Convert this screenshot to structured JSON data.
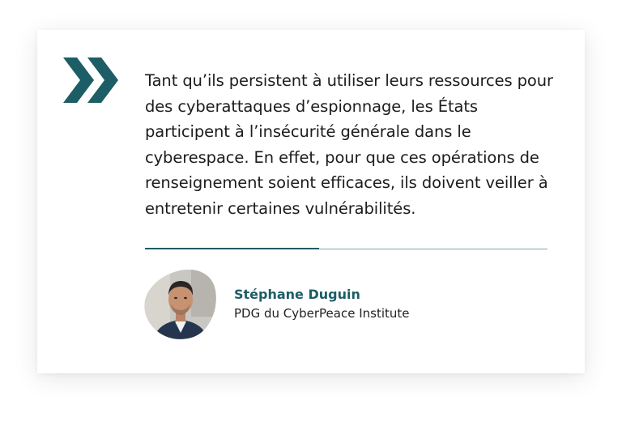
{
  "colors": {
    "accent": "#1d5d66",
    "accent_light": "#7ea6ab",
    "text": "#1c1c1c"
  },
  "quote": {
    "icon": "double-chevron-right-icon",
    "text": "Tant qu’ils persistent à utiliser leurs ressources pour des cyberattaques d’espionnage, les États participent à l’insécurité générale dans le cyberespace. En effet, pour que ces opérations de renseignement soient efficaces, ils doivent veiller à entretenir certaines vulnérabilités."
  },
  "author": {
    "name": "Stéphane Duguin",
    "title": "PDG du CyberPeace Institute"
  }
}
